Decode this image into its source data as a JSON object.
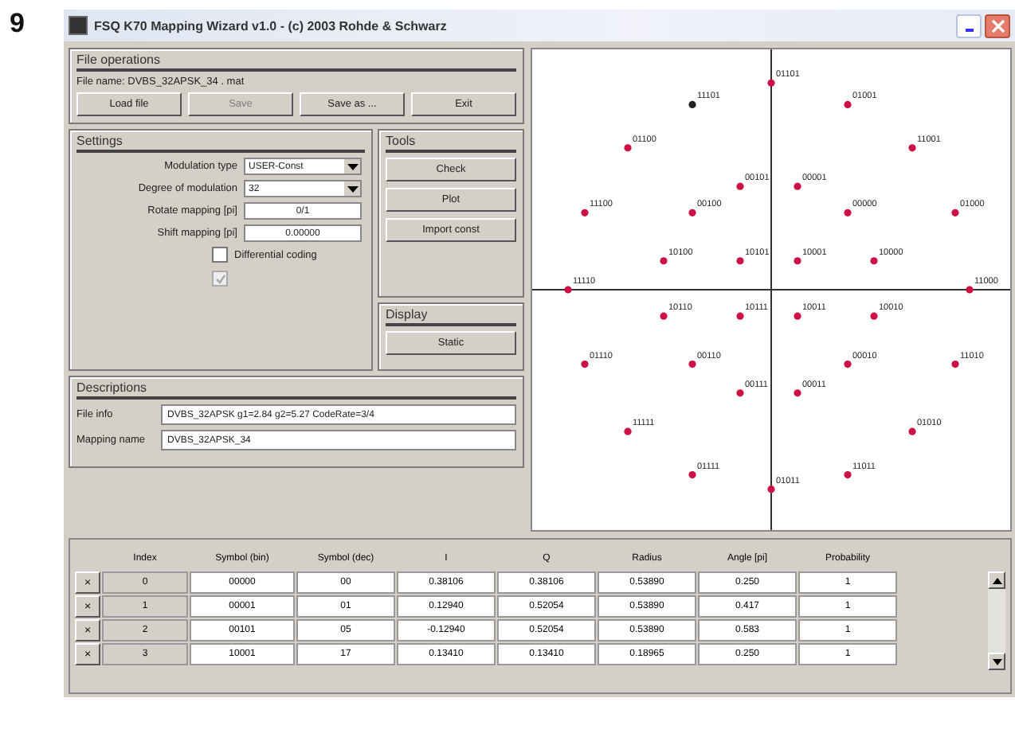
{
  "figure_number": "9",
  "window": {
    "title": "FSQ K70 Mapping Wizard v1.0  -  (c) 2003 Rohde & Schwarz"
  },
  "file_operations": {
    "title": "File operations",
    "file_name": "File name: DVBS_32APSK_34 . mat",
    "buttons": [
      {
        "label": "Load file",
        "disabled": false
      },
      {
        "label": "Save",
        "disabled": true
      },
      {
        "label": "Save as ...",
        "disabled": false
      },
      {
        "label": "Exit",
        "disabled": false
      }
    ]
  },
  "settings": {
    "title": "Settings",
    "fields": [
      {
        "kind": "dropdown",
        "label": "Modulation type",
        "value": "USER-Const"
      },
      {
        "kind": "dropdown",
        "label": "Degree of modulation",
        "value": "32"
      },
      {
        "kind": "input",
        "label": "Rotate mapping [pi]",
        "value": "0/1"
      },
      {
        "kind": "input",
        "label": "Shift mapping [pi]",
        "value": "0.00000"
      }
    ],
    "checkboxes": [
      {
        "label": "Differential coding",
        "checked": false,
        "disabled": false
      },
      {
        "checked": true,
        "disabled": true
      }
    ]
  },
  "tools": {
    "title": "Tools",
    "buttons": [
      "Check",
      "Plot",
      "Import const"
    ]
  },
  "display": {
    "title": "Display",
    "buttons": [
      "Static"
    ]
  },
  "descriptions": {
    "title": "Descriptions",
    "fields": [
      {
        "label": "File info",
        "value": "DVBS_32APSK g1=2.84 g2=5.27 CodeRate=3/4"
      },
      {
        "label": "Mapping name",
        "value": "DVBS_32APSK_34"
      }
    ]
  },
  "plot": {
    "points": [
      {
        "label": "01101",
        "selected": false
      },
      {
        "label": "11101",
        "selected": true
      },
      {
        "label": "01001",
        "selected": false
      },
      {
        "label": "01100",
        "selected": false
      },
      {
        "label": "11001",
        "selected": false
      },
      {
        "label": "00101",
        "selected": false
      },
      {
        "label": "00001",
        "selected": false
      },
      {
        "label": "11100",
        "selected": false
      },
      {
        "label": "00100",
        "selected": false
      },
      {
        "label": "00000",
        "selected": false
      },
      {
        "label": "01000",
        "selected": false
      },
      {
        "label": "10100",
        "selected": false
      },
      {
        "label": "10101",
        "selected": false
      },
      {
        "label": "10001",
        "selected": false
      },
      {
        "label": "10000",
        "selected": false
      },
      {
        "label": "11110",
        "selected": false
      },
      {
        "label": "11000",
        "selected": false
      },
      {
        "label": "10110",
        "selected": false
      },
      {
        "label": "10111",
        "selected": false
      },
      {
        "label": "10011",
        "selected": false
      },
      {
        "label": "10010",
        "selected": false
      },
      {
        "label": "01110",
        "selected": false
      },
      {
        "label": "00110",
        "selected": false
      },
      {
        "label": "00010",
        "selected": false
      },
      {
        "label": "11010",
        "selected": false
      },
      {
        "label": "00111",
        "selected": false
      },
      {
        "label": "00011",
        "selected": false
      },
      {
        "label": "11111",
        "selected": false
      },
      {
        "label": "01010",
        "selected": false
      },
      {
        "label": "01111",
        "selected": false
      },
      {
        "label": "11011",
        "selected": false
      },
      {
        "label": "01011",
        "selected": false
      }
    ]
  },
  "table": {
    "columns": [
      "Index",
      "Symbol (bin)",
      "Symbol (dec)",
      "I",
      "Q",
      "Radius",
      "Angle [pi]",
      "Probability"
    ],
    "row_button": "×",
    "rows": [
      [
        "0",
        "00000",
        "00",
        "0.38106",
        "0.38106",
        "0.53890",
        "0.250",
        "1"
      ],
      [
        "1",
        "00001",
        "01",
        "0.12940",
        "0.52054",
        "0.53890",
        "0.417",
        "1"
      ],
      [
        "2",
        "00101",
        "05",
        "-0.12940",
        "0.52054",
        "0.53890",
        "0.583",
        "1"
      ],
      [
        "3",
        "10001",
        "17",
        "0.13410",
        "0.13410",
        "0.18965",
        "0.250",
        "1"
      ]
    ]
  }
}
